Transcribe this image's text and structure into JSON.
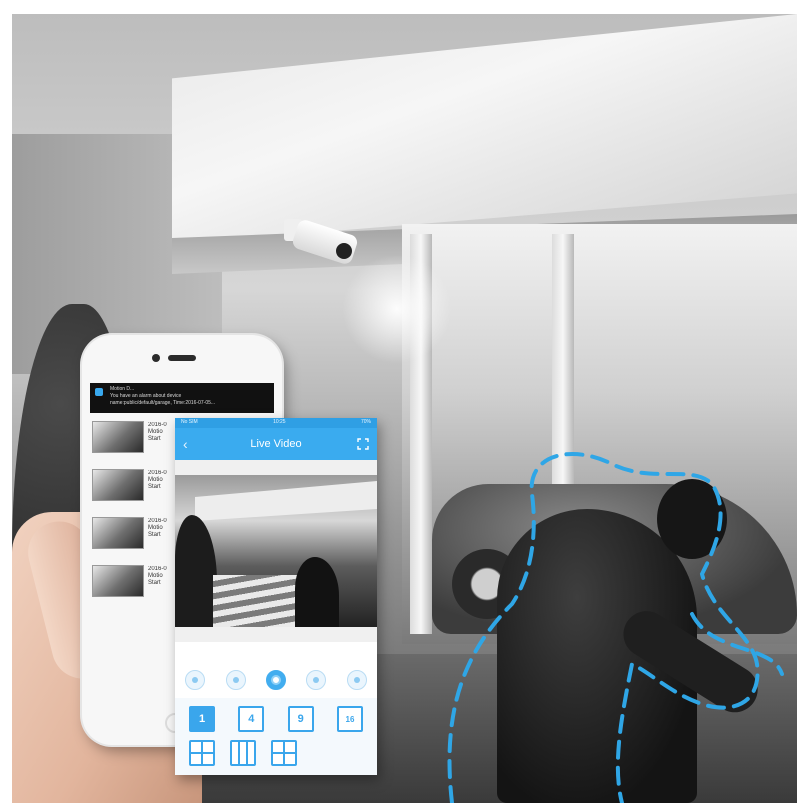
{
  "notification": {
    "title": "Motion D...",
    "line1": "You have an alarm about device",
    "line2": "name:public/default/garage, Time:2016-07-05..."
  },
  "events": [
    {
      "date": "2016-0",
      "l2": "Motio",
      "l3": "Start"
    },
    {
      "date": "2016-0",
      "l2": "Motio",
      "l3": "Start"
    },
    {
      "date": "2016-0",
      "l2": "Motio",
      "l3": "Start"
    },
    {
      "date": "2016-0",
      "l2": "Motio",
      "l3": "Start"
    }
  ],
  "app": {
    "status_left": "No SIM",
    "status_center": "10:25",
    "status_right": "70%",
    "title": "Live Video",
    "back_glyph": "‹",
    "layout_buttons": [
      {
        "label": "1",
        "icon": "single-view-icon",
        "active": true
      },
      {
        "label": "4",
        "icon": "quad-view-icon",
        "active": false
      },
      {
        "label": "9",
        "icon": "nine-view-icon",
        "active": false
      },
      {
        "label": "16",
        "icon": "sixteen-view-icon",
        "active": false
      },
      {
        "label": "",
        "icon": "split-view-icon",
        "active": false
      },
      {
        "label": "",
        "icon": "grid-view-icon",
        "active": false
      },
      {
        "label": "",
        "icon": "wide-view-icon",
        "active": false
      }
    ],
    "controls": [
      "microphone-icon",
      "speaker-icon",
      "record-icon",
      "snapshot-icon",
      "lock-icon"
    ]
  },
  "colors": {
    "accent": "#3aabef",
    "motion_outline": "#2fa6e6"
  }
}
